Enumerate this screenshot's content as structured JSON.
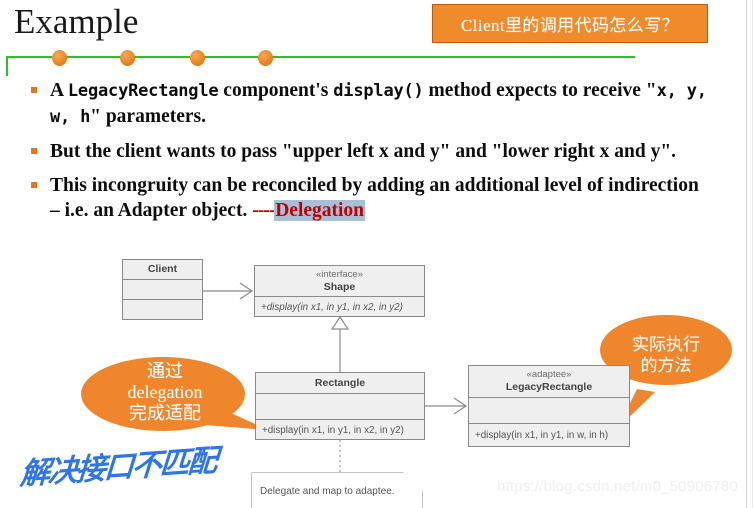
{
  "slide": {
    "title": "Example",
    "header_callout": "Client里的调用代码怎么写？"
  },
  "bullets": [
    {
      "id": "bullet-1",
      "segments": [
        {
          "text": "A ",
          "style": "normal"
        },
        {
          "text": "LegacyRectangle",
          "style": "mono"
        },
        {
          "text": " component's ",
          "style": "normal"
        },
        {
          "text": "display()",
          "style": "mono"
        },
        {
          "text": " method expects to receive \"",
          "style": "normal"
        },
        {
          "text": "x, y, w, h",
          "style": "mono"
        },
        {
          "text": "\" parameters.",
          "style": "normal"
        }
      ],
      "plain": "A LegacyRectangle component's display() method expects to receive \"x, y, w, h\" parameters."
    },
    {
      "id": "bullet-2",
      "plain": "But the client wants to pass \"upper left  x  and y\" and \"lower right x and y\"."
    },
    {
      "id": "bullet-3",
      "lead": "This incongruity can be reconciled by adding an additional level of indirection – i.e. an Adapter object.",
      "dashes": "----",
      "highlight": "Delegation"
    }
  ],
  "divider": {
    "line_color": "#27C423",
    "dot_color": "#ED8B28",
    "dots_x": [
      52,
      120,
      190,
      258
    ]
  },
  "uml": {
    "client": {
      "name": "Client",
      "stereotype": "",
      "rows": [
        "",
        ""
      ]
    },
    "shape": {
      "stereotype": "«interface»",
      "name": "Shape",
      "operation": "+display(in x1, in y1, in x2, in y2)"
    },
    "rectangle": {
      "stereotype": "",
      "name": "Rectangle",
      "attributes": "",
      "operation": "+display(in x1, in y1, in x2, in y2)"
    },
    "legacy_rectangle": {
      "stereotype": "«adaptee»",
      "name": "LegacyRectangle",
      "attributes": "",
      "operation": "+display(in x1, in y1, in w, in h)"
    },
    "note": "Delegate and map to adaptee."
  },
  "callouts": {
    "left_bubble": {
      "line1": "通过",
      "line2": "delegation",
      "line3": "完成适配",
      "color": "#F0862C"
    },
    "right_bubble": {
      "line1": "实际执行",
      "line2": "的方法",
      "color": "#F0862C"
    }
  },
  "annotation": {
    "handwriting": "解决接口不匹配",
    "color": "#2E75E8"
  },
  "watermark": {
    "text": "https://blog.csdn.net/m0_50906780"
  }
}
